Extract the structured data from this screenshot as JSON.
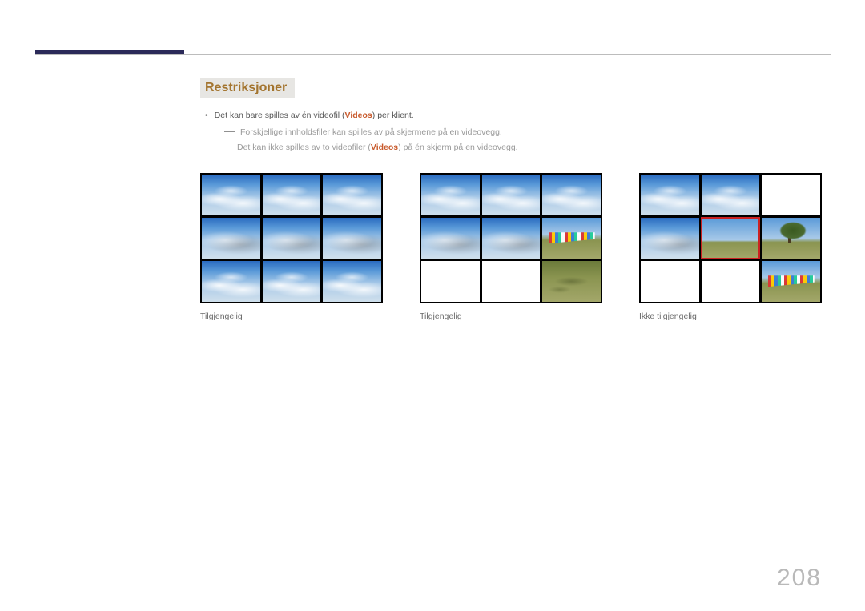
{
  "heading": "Restriksjoner",
  "bullet": {
    "pre": "Det kan bare spilles av én videofil (",
    "videos": "Videos",
    "post": ") per klient."
  },
  "sub1": "Forskjellige innholdsfiler kan spilles av på skjermene på en videovegg.",
  "sub2": {
    "pre": "Det kan ikke spilles av to videofiler (",
    "videos": "Videos",
    "post": ") på én skjerm på en videovegg."
  },
  "captions": {
    "c1": "Tilgjengelig",
    "c2": "Tilgjengelig",
    "c3": "Ikke tilgjengelig"
  },
  "page": "208"
}
